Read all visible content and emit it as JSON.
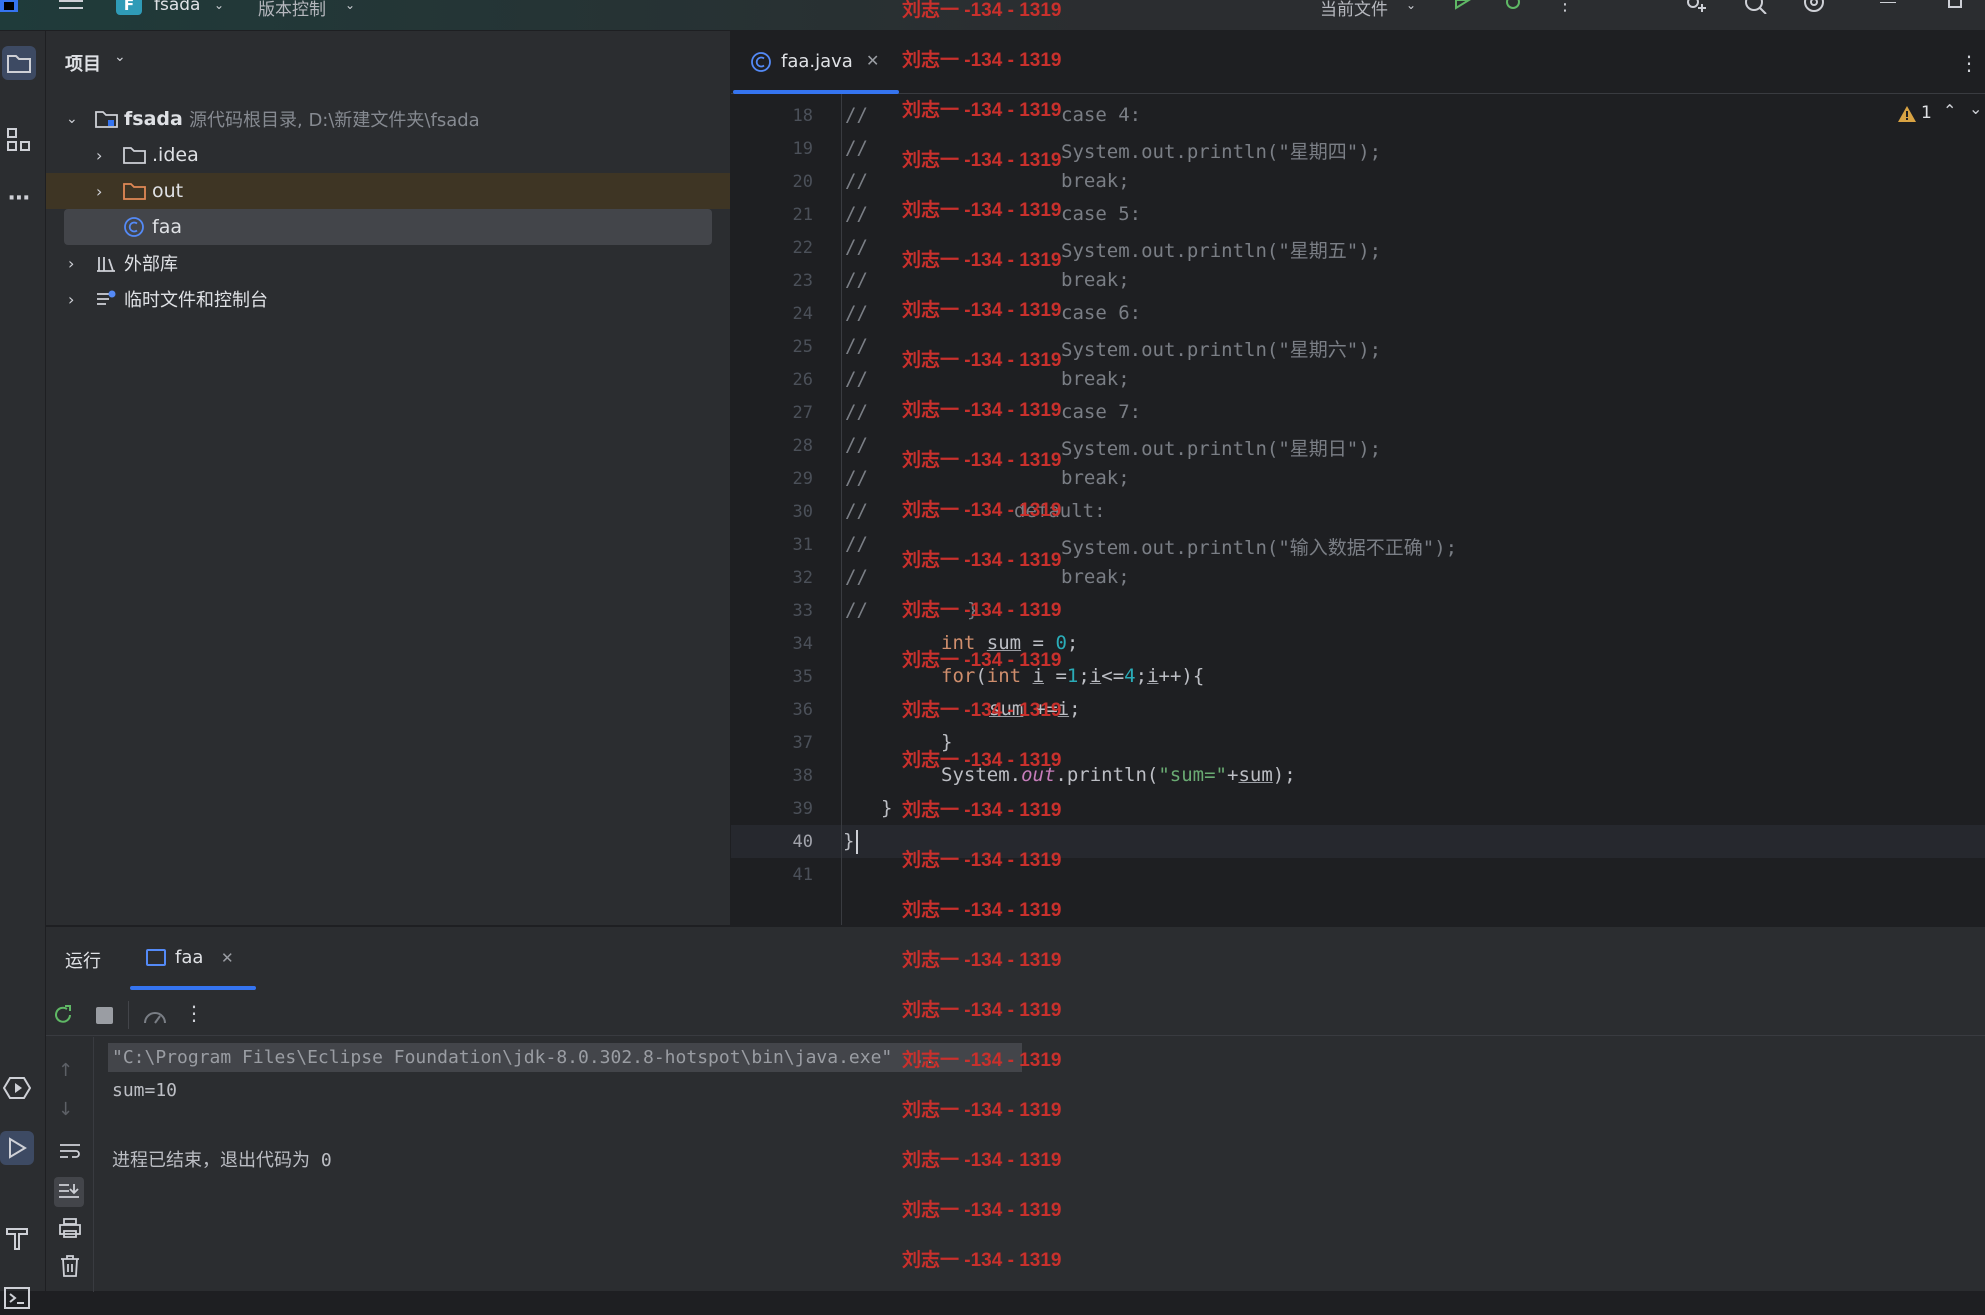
{
  "titlebar": {
    "project_initial": "F",
    "project_name": "fsada",
    "vcs_label": "版本控制",
    "run_config": "当前文件"
  },
  "project_panel": {
    "title": "项目",
    "root_name": "fsada",
    "root_hint": "源代码根目录, D:\\新建文件夹\\fsada",
    "items": [
      {
        "label": ".idea"
      },
      {
        "label": "out"
      },
      {
        "label": "faa"
      },
      {
        "label": "外部库"
      },
      {
        "label": "临时文件和控制台"
      }
    ]
  },
  "editor": {
    "tab_label": "faa.java",
    "warning_count": "1",
    "line_numbers": [
      "18",
      "19",
      "20",
      "21",
      "22",
      "23",
      "24",
      "25",
      "26",
      "27",
      "28",
      "29",
      "30",
      "31",
      "32",
      "33",
      "34",
      "35",
      "36",
      "37",
      "38",
      "39",
      "40",
      "41"
    ]
  },
  "code": {
    "l18": "case 4:",
    "l19": "System.out.println(\"星期四\");",
    "l20": "break;",
    "l21": "case 5:",
    "l22": "System.out.println(\"星期五\");",
    "l23": "break;",
    "l24": "case 6:",
    "l25": "System.out.println(\"星期六\");",
    "l26": "break;",
    "l27": "case 7:",
    "l28": "System.out.println(\"星期日\");",
    "l29": "break;",
    "l30": "default:",
    "l31": "System.out.println(\"输入数据不正确\");",
    "l32": "break;",
    "l33": "}",
    "comment_marker": "//",
    "l34_kw": "int",
    "l34_var": "sum",
    "l34_eq": " = ",
    "l34_num": "0",
    "l34_end": ";",
    "l35_for": "for",
    "l35_open": "(",
    "l35_int": "int",
    "l35_i1": "i",
    "l35_eq": " =",
    "l35_n1": "1",
    "l35_semi1": ";",
    "l35_i2": "i",
    "l35_lt": "<=",
    "l35_n4": "4",
    "l35_semi2": ";",
    "l35_i3": "i",
    "l35_rest": "++){",
    "l36_sum": "sum",
    "l36_op": " +=",
    "l36_i": "i",
    "l36_end": ";",
    "l37": "}",
    "l38_a": "System.",
    "l38_out": "out",
    "l38_b": ".println(",
    "l38_str": "\"sum=\"",
    "l38_plus": "+",
    "l38_sum": "sum",
    "l38_end": ");",
    "l39": "}",
    "l40": "}"
  },
  "watermark": {
    "text": "刘志一 -134 - 1319"
  },
  "run_panel": {
    "title": "运行",
    "tab_label": "faa",
    "console_lines": [
      "\"C:\\Program Files\\Eclipse Foundation\\jdk-8.0.302.8-hotspot\\bin\\java.exe\" ...",
      "sum=10",
      "",
      "进程已结束，退出代码为 0"
    ]
  },
  "colors": {
    "accent": "#3574f0",
    "watermark": "#c9302c",
    "keyword": "#cf8e6d",
    "number": "#2aacb8",
    "string": "#6aab73"
  }
}
